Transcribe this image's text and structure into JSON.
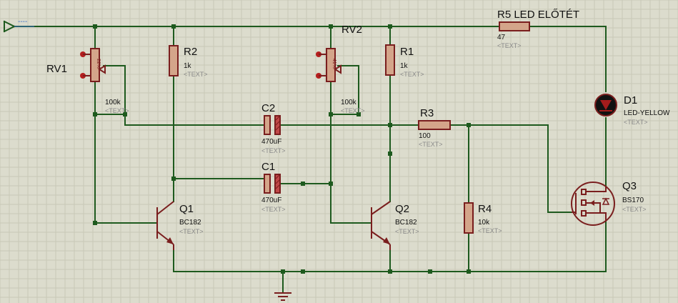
{
  "colors": {
    "background": "#dcdccd",
    "grid": "#c8c8b6",
    "wire": "#1e5a1e",
    "component": "#7a1e1e",
    "resistor_fill": "#d4a58a"
  },
  "text_placeholder": "<TEXT>",
  "power_terminal": {
    "label": "----"
  },
  "components": {
    "rv1": {
      "ref": "RV1",
      "value": "100k",
      "percent": "22%"
    },
    "rv2": {
      "ref": "RV2",
      "value": "100k",
      "percent": "41%"
    },
    "r1": {
      "ref": "R1",
      "value": "1k"
    },
    "r2": {
      "ref": "R2",
      "value": "1k"
    },
    "r3": {
      "ref": "R3",
      "value": "100"
    },
    "r4": {
      "ref": "R4",
      "value": "10k"
    },
    "r5": {
      "ref": "R5 LED ELŐTÉT",
      "value": "47"
    },
    "c1": {
      "ref": "C1",
      "value": "470uF"
    },
    "c2": {
      "ref": "C2",
      "value": "470uF"
    },
    "q1": {
      "ref": "Q1",
      "value": "BC182"
    },
    "q2": {
      "ref": "Q2",
      "value": "BC182"
    },
    "q3": {
      "ref": "Q3",
      "value": "BS170"
    },
    "d1": {
      "ref": "D1",
      "value": "LED-YELLOW"
    }
  }
}
